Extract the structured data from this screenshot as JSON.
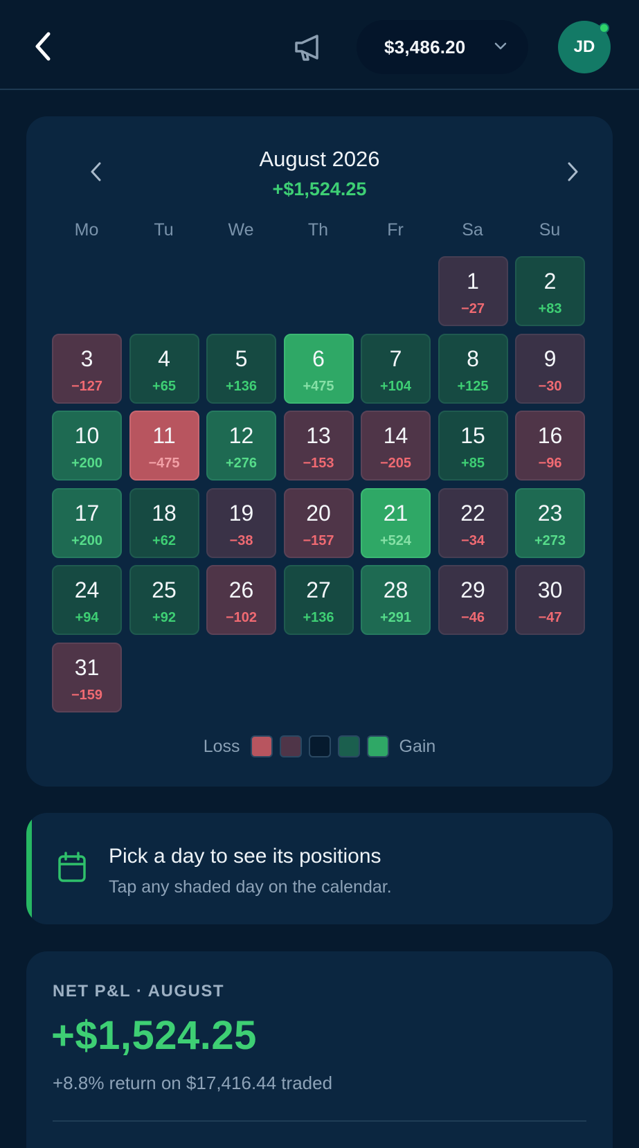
{
  "header": {
    "balance": "$3,486.20",
    "avatar_initials": "JD",
    "icons": [
      "chevron-left-icon",
      "megaphone-icon",
      "chevron-down-icon"
    ]
  },
  "calendar": {
    "month_title": "August 2026",
    "month_total": "+$1,524.25",
    "weekdays": [
      "Mo",
      "Tu",
      "We",
      "Th",
      "Fr",
      "Sa",
      "Su"
    ],
    "first_weekday_index": 5,
    "days": [
      {
        "day": "1",
        "pnl": "−27"
      },
      {
        "day": "2",
        "pnl": "+83"
      },
      {
        "day": "3",
        "pnl": "−127"
      },
      {
        "day": "4",
        "pnl": "+65"
      },
      {
        "day": "5",
        "pnl": "+136"
      },
      {
        "day": "6",
        "pnl": "+475"
      },
      {
        "day": "7",
        "pnl": "+104"
      },
      {
        "day": "8",
        "pnl": "+125"
      },
      {
        "day": "9",
        "pnl": "−30"
      },
      {
        "day": "10",
        "pnl": "+200"
      },
      {
        "day": "11",
        "pnl": "−475"
      },
      {
        "day": "12",
        "pnl": "+276"
      },
      {
        "day": "13",
        "pnl": "−153"
      },
      {
        "day": "14",
        "pnl": "−205"
      },
      {
        "day": "15",
        "pnl": "+85"
      },
      {
        "day": "16",
        "pnl": "−96"
      },
      {
        "day": "17",
        "pnl": "+200"
      },
      {
        "day": "18",
        "pnl": "+62"
      },
      {
        "day": "19",
        "pnl": "−38"
      },
      {
        "day": "20",
        "pnl": "−157"
      },
      {
        "day": "21",
        "pnl": "+524"
      },
      {
        "day": "22",
        "pnl": "−34"
      },
      {
        "day": "23",
        "pnl": "+273"
      },
      {
        "day": "24",
        "pnl": "+94"
      },
      {
        "day": "25",
        "pnl": "+92"
      },
      {
        "day": "26",
        "pnl": "−102"
      },
      {
        "day": "27",
        "pnl": "+136"
      },
      {
        "day": "28",
        "pnl": "+291"
      },
      {
        "day": "29",
        "pnl": "−46"
      },
      {
        "day": "30",
        "pnl": "−47"
      },
      {
        "day": "31",
        "pnl": "−159"
      }
    ],
    "legend": {
      "loss_label": "Loss",
      "gain_label": "Gain",
      "swatches": [
        "#b8555f",
        "#4f3548",
        "#061a2e",
        "#1b5f4e",
        "#2fa866"
      ]
    }
  },
  "hint": {
    "title": "Pick a day to see its positions",
    "subtitle": "Tap any shaded day on the calendar."
  },
  "summary": {
    "label": "NET P&L · AUGUST",
    "value": "+$1,524.25",
    "subtitle": "+8.8% return on $17,416.44 traded"
  },
  "colors": {
    "background": "#061a2e",
    "card": "#0b2640",
    "gain_text": "#3ecf74",
    "loss_text": "#f06a72",
    "accent": "#27b863"
  }
}
